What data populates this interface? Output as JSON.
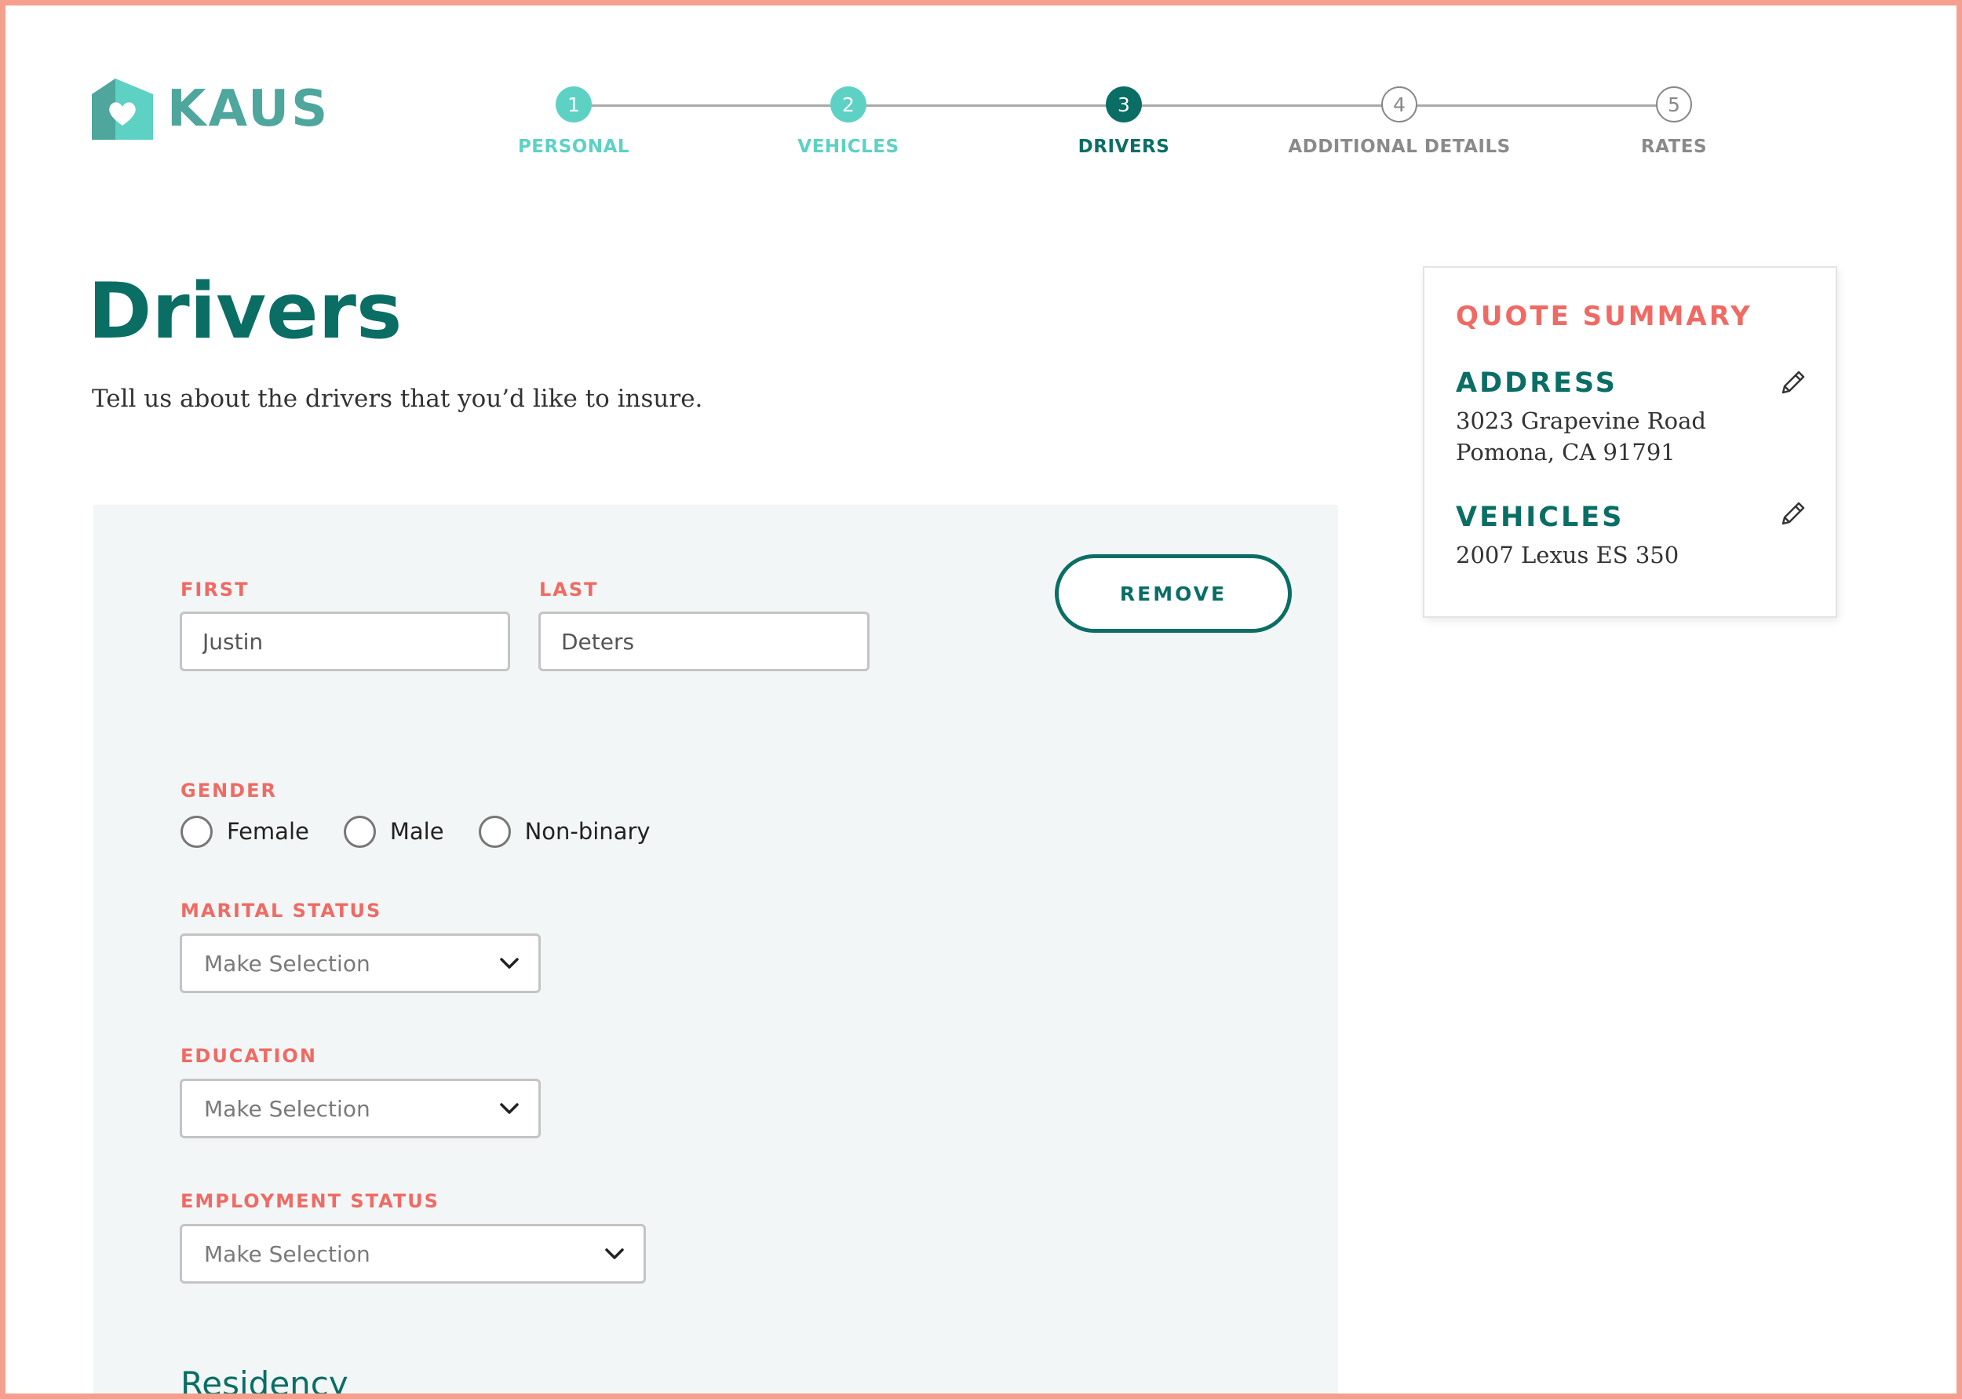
{
  "brand": {
    "name": "KAUS",
    "primary_color": "#0a6e65",
    "accent_color": "#5dd1c4",
    "label_color": "#f06a64",
    "frame_color": "#f5a08e"
  },
  "stepper": {
    "steps": [
      {
        "number": "1",
        "label": "PERSONAL",
        "state": "done"
      },
      {
        "number": "2",
        "label": "VEHICLES",
        "state": "done"
      },
      {
        "number": "3",
        "label": "DRIVERS",
        "state": "active"
      },
      {
        "number": "4",
        "label": "ADDITIONAL DETAILS",
        "state": "todo"
      },
      {
        "number": "5",
        "label": "RATES",
        "state": "todo"
      }
    ]
  },
  "page": {
    "title": "Drivers",
    "subtitle": "Tell us about the drivers that you’d like to insure."
  },
  "form": {
    "first": {
      "label": "FIRST",
      "value": "Justin"
    },
    "last": {
      "label": "LAST",
      "value": "Deters"
    },
    "remove_label": "REMOVE",
    "gender": {
      "label": "GENDER",
      "options": [
        "Female",
        "Male",
        "Non-binary"
      ]
    },
    "marital_status": {
      "label": "MARITAL STATUS",
      "value": "Make Selection"
    },
    "education": {
      "label": "EDUCATION",
      "value": "Make Selection"
    },
    "employment_status": {
      "label": "EMPLOYMENT STATUS",
      "value": "Make Selection"
    },
    "residency_title": "Residency"
  },
  "summary": {
    "title": "QUOTE SUMMARY",
    "address": {
      "heading": "ADDRESS",
      "line1": "3023 Grapevine Road",
      "line2": "Pomona, CA 91791"
    },
    "vehicles": {
      "heading": "VEHICLES",
      "line1": "2007 Lexus ES 350"
    }
  }
}
